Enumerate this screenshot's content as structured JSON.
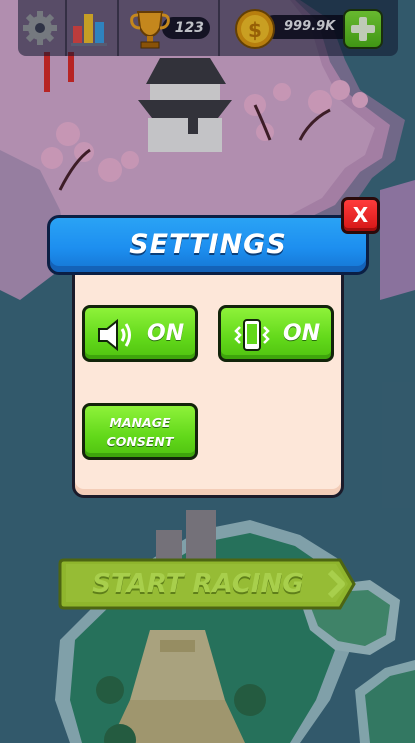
{
  "hud": {
    "trophy_count": "123",
    "coin_count": "999.9K",
    "icons": [
      "gear-icon",
      "leaderboard-icon",
      "trophy-icon",
      "coin-icon",
      "plus-icon"
    ]
  },
  "settings": {
    "title": "SETTINGS",
    "close_label": "X",
    "sound": {
      "icon": "speaker-icon",
      "state": "ON"
    },
    "vibration": {
      "icon": "vibration-icon",
      "state": "ON"
    },
    "consent": {
      "line1": "MANAGE",
      "line2": "CONSENT"
    }
  },
  "start": {
    "label": "START RACING"
  },
  "colors": {
    "header_blue": "#1d8ff0",
    "button_green": "#62d81a",
    "panel_cream": "#fde7d9",
    "close_red": "#e01e1e",
    "start_green": "#8fb52d"
  }
}
